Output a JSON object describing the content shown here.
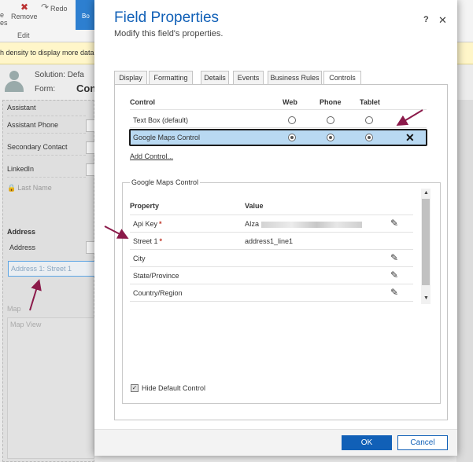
{
  "app": {
    "ribbon": {
      "partial_left": "e",
      "partial_left_2": "es",
      "remove_label": "Remove",
      "redo_label": "Redo",
      "edit_group": "Edit",
      "body_partial": "Bo"
    },
    "infobar_text": "h density to display more data",
    "header": {
      "solution_label": "Solution: Defa",
      "form_label": "Form:",
      "form_value": "Con"
    },
    "fields": [
      "Assistant",
      "Assistant Phone",
      "Secondary Contact",
      "LinkedIn"
    ],
    "field_box_hint": "As",
    "locked_field": "Last Name",
    "address_section": "Address",
    "address_field": "Address",
    "address_street_placeholder": "Address 1: Street 1",
    "map_section": "Map",
    "map_field": "Map View"
  },
  "dialog": {
    "title": "Field Properties",
    "subtitle": "Modify this field's properties.",
    "help_label": "?",
    "close_label": "✕",
    "tabs": [
      "Display",
      "Formatting",
      "Details",
      "Events",
      "Business Rules",
      "Controls"
    ],
    "active_tab": "Controls",
    "controls_table": {
      "headers": {
        "control": "Control",
        "web": "Web",
        "phone": "Phone",
        "tablet": "Tablet"
      },
      "rows": [
        {
          "name": "Text Box (default)",
          "web": false,
          "phone": false,
          "tablet": false
        },
        {
          "name": "Google Maps Control",
          "web": true,
          "phone": true,
          "tablet": true,
          "selected": true
        }
      ],
      "remove_label": "✕"
    },
    "add_control_label": "Add Control...",
    "properties": {
      "legend": "Google Maps Control",
      "headers": {
        "property": "Property",
        "value": "Value"
      },
      "rows": [
        {
          "name": "Api Key",
          "required": true,
          "value": "AIza",
          "value_blurred": true,
          "editable": true
        },
        {
          "name": "Street 1",
          "required": true,
          "value": "address1_line1",
          "editable": false
        },
        {
          "name": "City",
          "required": false,
          "value": "",
          "editable": true
        },
        {
          "name": "State/Province",
          "required": false,
          "value": "",
          "editable": true
        },
        {
          "name": "Country/Region",
          "required": false,
          "value": "",
          "editable": true
        }
      ],
      "required_mark": "*"
    },
    "hide_default_label": "Hide Default Control",
    "hide_default_checked": true,
    "checkbox_mark": "✓",
    "ok_label": "OK",
    "cancel_label": "Cancel"
  },
  "colors": {
    "accent": "#1160b7",
    "selected_row": "#b9d9f2",
    "annotation_arrow": "#8b1a4a",
    "required": "#c0392b"
  },
  "icons": {
    "pencil": "pencil-icon",
    "scroll_up": "scroll-up-icon",
    "scroll_down": "scroll-down-icon"
  }
}
